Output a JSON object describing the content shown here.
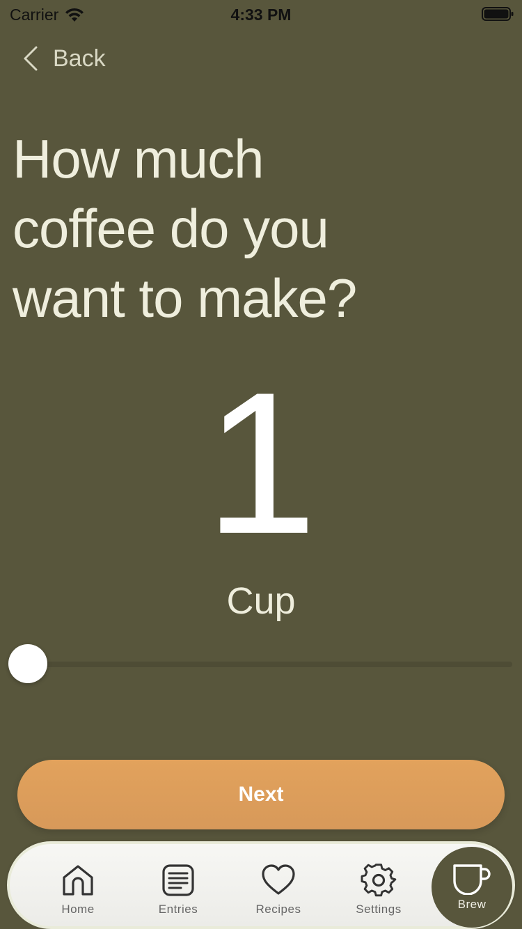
{
  "status_bar": {
    "carrier": "Carrier",
    "time": "4:33 PM"
  },
  "nav": {
    "back_label": "Back"
  },
  "question": {
    "line1": "How much",
    "line2": "coffee do you",
    "line3": "want to make?"
  },
  "amount": {
    "value": "1",
    "unit": "Cup"
  },
  "slider": {
    "fraction": 0.0
  },
  "next_button": {
    "label": "Next"
  },
  "tab_bar": {
    "items": [
      {
        "label": "Home",
        "icon": "home-icon"
      },
      {
        "label": "Entries",
        "icon": "entries-icon"
      },
      {
        "label": "Recipes",
        "icon": "heart-icon"
      },
      {
        "label": "Settings",
        "icon": "gear-icon"
      }
    ],
    "brew": {
      "label": "Brew",
      "icon": "cup-icon"
    }
  },
  "colors": {
    "background": "#58563c",
    "accent": "#e2a25c",
    "text": "#efeedd"
  }
}
